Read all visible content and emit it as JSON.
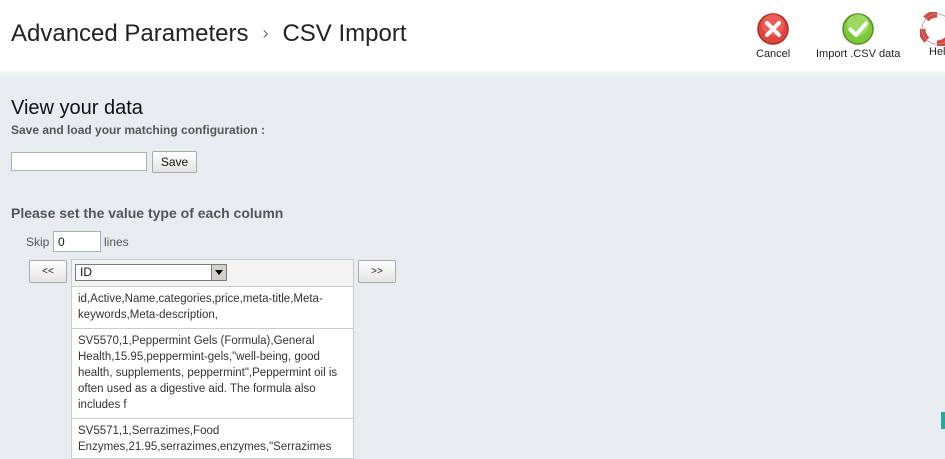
{
  "header": {
    "breadcrumb": [
      "Advanced Parameters",
      "CSV Import"
    ],
    "separator": "›",
    "toolbar": [
      {
        "label": "Cancel",
        "icon": "cancel-icon",
        "color": "#e0463e"
      },
      {
        "label": "Import .CSV data",
        "icon": "check-icon",
        "color": "#7fc83a"
      },
      {
        "label": "Help",
        "icon": "help-icon",
        "color": "#d9463f"
      }
    ]
  },
  "view": {
    "title": "View your data",
    "config_label": "Save and load your matching configuration :",
    "config_input_value": "",
    "save_label": "Save",
    "section_title": "Please set the value type of each column",
    "skip_label": "Skip",
    "skip_value": "0",
    "lines_label": "lines",
    "prev_label": "<<",
    "next_label": ">>"
  },
  "column": {
    "selected_type": "ID",
    "cells": [
      "id,Active,Name,categories,price,meta-title,Meta-keywords,Meta-description,",
      "SV5570,1,Peppermint Gels (Formula),General Health,15.95,peppermint-gels,\"well-being, good health, supplements, peppermint\",Peppermint oil is often used as a digestive aid. The formula also includes f",
      "SV5571,1,Serrazimes,Food Enzymes,21.95,serrazimes,enzymes,\"Serrazimes"
    ]
  }
}
